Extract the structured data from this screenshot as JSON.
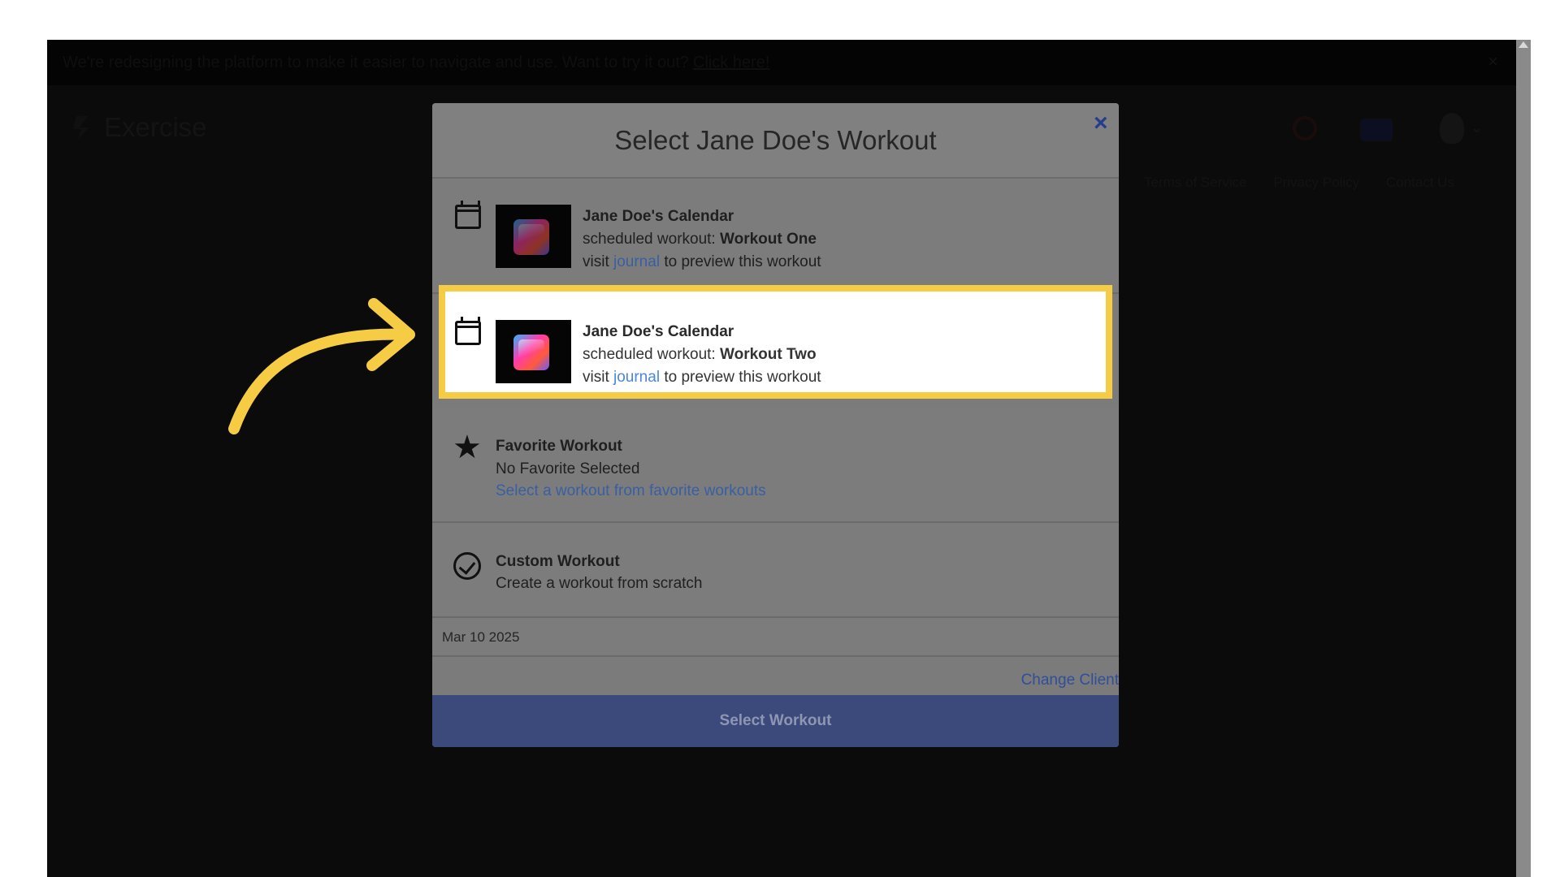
{
  "banner": {
    "text": "We're redesigning the platform to make it easier to navigate and use. Want to try it out?",
    "link": "Click here!",
    "close": "×"
  },
  "header": {
    "app_title": "Exercise"
  },
  "footer_links": [
    "Terms of Service",
    "Privacy Policy",
    "Contact Us"
  ],
  "modal": {
    "title": "Select Jane Doe's Workout",
    "close": "×",
    "options": [
      {
        "title": "Jane Doe's Calendar",
        "prefix": "scheduled workout: ",
        "workout": "Workout One",
        "visit": "visit ",
        "link": "journal",
        "suffix": " to preview this workout",
        "icon": "calendar-icon"
      },
      {
        "title": "Jane Doe's Calendar",
        "prefix": "scheduled workout: ",
        "workout": "Workout Two",
        "visit": "visit ",
        "link": "journal",
        "suffix": " to preview this workout",
        "icon": "calendar-icon",
        "highlighted": true
      },
      {
        "title": "Favorite Workout",
        "line1": "No Favorite Selected",
        "link": "Select a workout from favorite workouts",
        "icon": "star-icon"
      },
      {
        "title": "Custom Workout",
        "line1": "Create a workout from scratch",
        "icon": "check-circle-icon"
      }
    ],
    "date": "Mar 10 2025",
    "change_client": "Change Client",
    "select_button": "Select Workout"
  },
  "colors": {
    "highlight": "#f6cc45",
    "annotation_arrow": "#f6cc45",
    "link": "#4a86e0",
    "primary_button": "#3b4a7b"
  }
}
